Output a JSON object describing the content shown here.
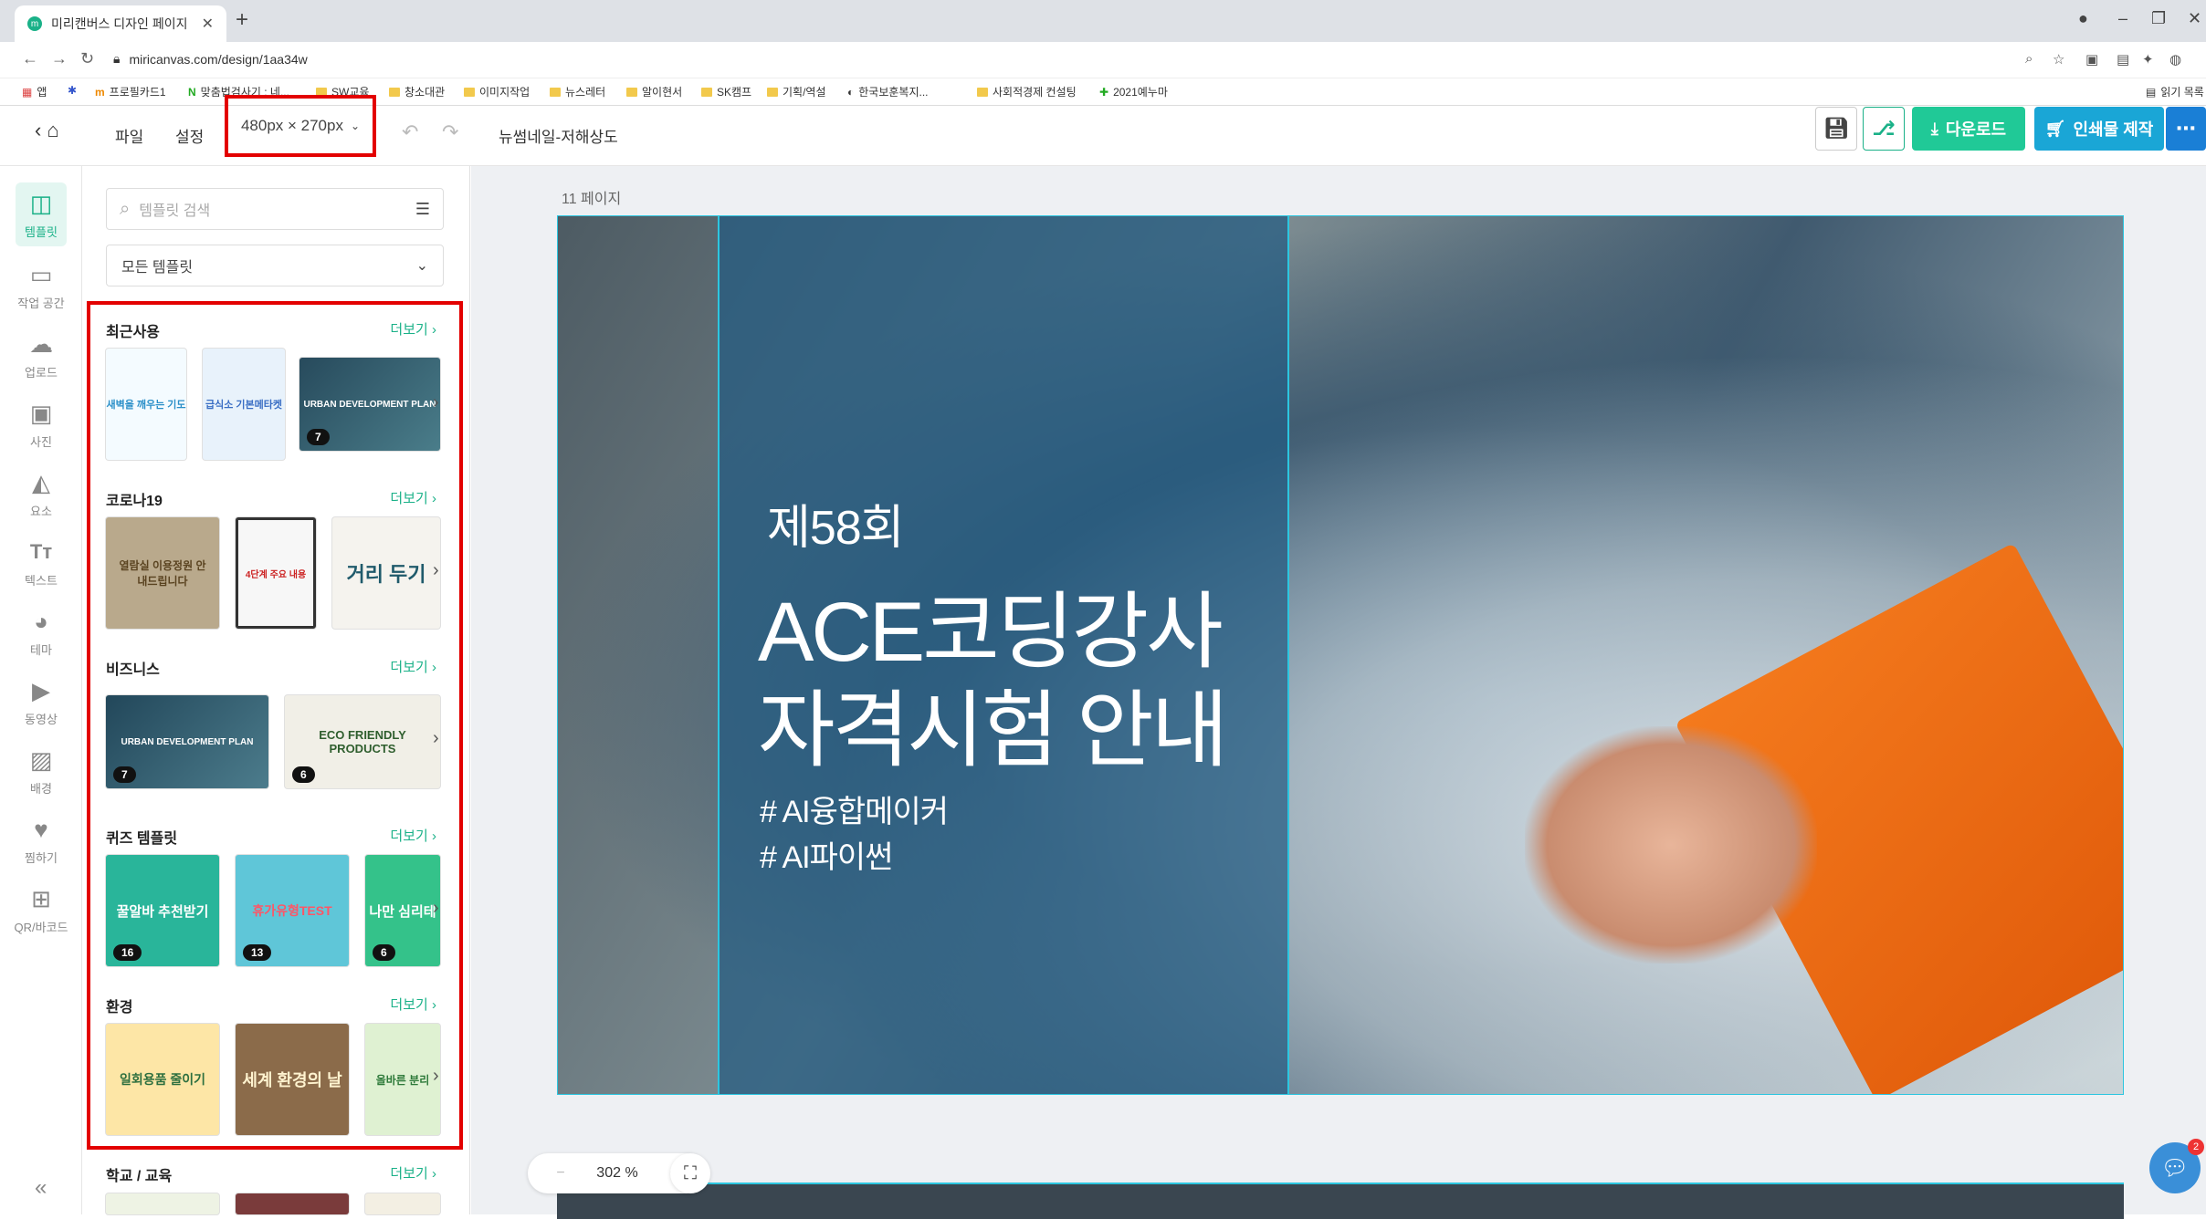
{
  "browser": {
    "tab_title": "미리캔버스 디자인 페이지",
    "url": "miricanvas.com/design/1aa34w",
    "bookmarks": [
      "앱",
      "프로필카드1",
      "맞춤법검사기 : 네...",
      "SW교육",
      "창소대관",
      "이미지작업",
      "뉴스레터",
      "알이현서",
      "SK캠프",
      "기획/역설",
      "한국보훈복지...",
      "사회적경제 컨설팅",
      "2021예누마"
    ],
    "reading_list": "읽기 목록"
  },
  "header": {
    "file": "파일",
    "settings": "설정",
    "size": "480px × 270px",
    "doc_title": "뉴썸네일-저해상도",
    "download": "다운로드",
    "print": "인쇄물 제작"
  },
  "rail": [
    "템플릿",
    "작업 공간",
    "업로드",
    "사진",
    "요소",
    "텍스트",
    "테마",
    "동영상",
    "배경",
    "찜하기",
    "QR/바코드"
  ],
  "panel": {
    "search_placeholder": "템플릿 검색",
    "dropdown": "모든 템플릿",
    "more": "더보기",
    "categories": [
      {
        "name": "최근사용",
        "thumbs": [
          {
            "text": "새벽을 깨우는 기도"
          },
          {
            "text": "급식소 기본메타켓"
          },
          {
            "text": "URBAN DEVELOPMENT PLAN",
            "badge": "7"
          }
        ]
      },
      {
        "name": "코로나19",
        "thumbs": [
          {
            "text": "열람실 이용정원 안내드립니다"
          },
          {
            "text": "4단계 주요 내용"
          },
          {
            "text": "거리 두기"
          }
        ]
      },
      {
        "name": "비즈니스",
        "thumbs": [
          {
            "text": "URBAN DEVELOPMENT PLAN",
            "badge": "7"
          },
          {
            "text": "ECO FRIENDLY PRODUCTS",
            "badge": "6"
          }
        ]
      },
      {
        "name": "퀴즈 템플릿",
        "thumbs": [
          {
            "text": "꿀알바 추천받기",
            "badge": "16"
          },
          {
            "text": "휴가유형TEST",
            "badge": "13"
          },
          {
            "text": "나만 심리테",
            "badge": "6"
          }
        ]
      },
      {
        "name": "환경",
        "thumbs": [
          {
            "text": "일회용품 줄이기"
          },
          {
            "text": "세계 환경의 날"
          },
          {
            "text": "올바른 분리"
          }
        ]
      },
      {
        "name": "학교 / 교육",
        "thumbs": []
      }
    ]
  },
  "canvas": {
    "page_label": "11 페이지",
    "zoom": "302 %",
    "slide": {
      "line1": "제58회",
      "line2": "ACE코딩강사",
      "line3": "자격시험 안내",
      "tag1": "# AI융합메이커",
      "tag2": "# AI파이썬"
    }
  },
  "chat_badge": "2"
}
